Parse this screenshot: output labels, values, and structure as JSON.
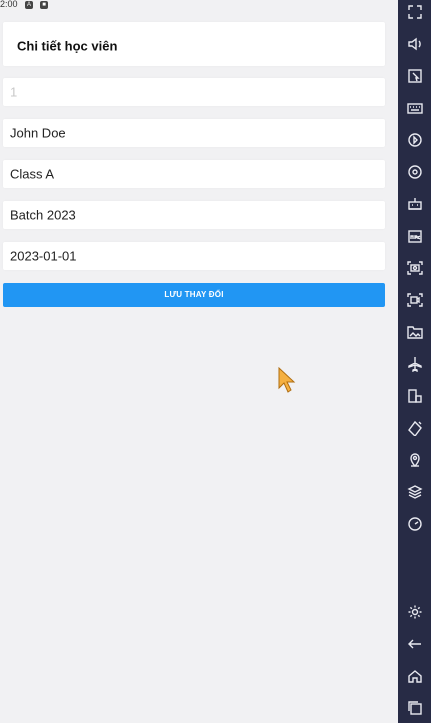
{
  "status_bar": {
    "time": "2:00"
  },
  "page": {
    "title": "Chi tiết học viên"
  },
  "form": {
    "fields": [
      {
        "name": "id",
        "value": "1"
      },
      {
        "name": "student-name",
        "value": "John Doe"
      },
      {
        "name": "class",
        "value": "Class A"
      },
      {
        "name": "batch",
        "value": "Batch 2023"
      },
      {
        "name": "date",
        "value": "2023-01-01"
      }
    ],
    "save_label": "LƯU THAY ĐỔI"
  },
  "theme": {
    "accent": "#2196f3",
    "background": "#f1f1f3",
    "sidebar": "#272b45"
  },
  "emulator_sidebar": {
    "icons": [
      "fullscreen-icon",
      "volume-icon",
      "touch-icon",
      "keyboard-icon",
      "record-icon",
      "sync-icon",
      "robot-icon",
      "apk-icon",
      "screenshot-icon",
      "screen-record-icon",
      "gallery-icon",
      "airplane-icon",
      "multi-window-icon",
      "rotate-icon",
      "location-icon",
      "layers-icon",
      "speedometer-icon",
      "settings-icon",
      "back-icon",
      "home-icon",
      "recents-icon"
    ]
  }
}
